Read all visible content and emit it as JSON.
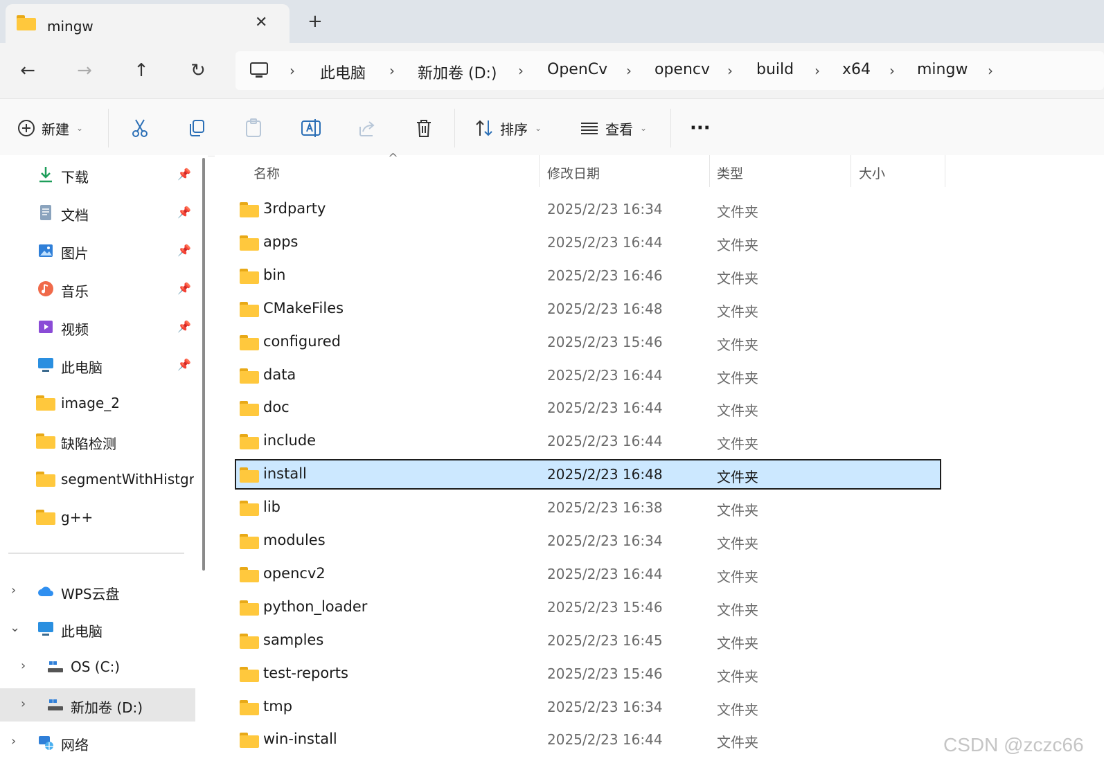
{
  "tab": {
    "title": "mingw",
    "close": "✕",
    "new_tab": "+"
  },
  "nav": {
    "back": "←",
    "forward": "→",
    "up": "↑",
    "refresh": "↻"
  },
  "breadcrumb": [
    "此电脑",
    "新加卷 (D:)",
    "OpenCv",
    "opencv",
    "build",
    "x64",
    "mingw"
  ],
  "toolbar": {
    "new_label": "新建",
    "sort_label": "排序",
    "view_label": "查看",
    "more": "···"
  },
  "sidebar": {
    "quick": [
      {
        "label": "下载",
        "icon": "download-icon"
      },
      {
        "label": "文档",
        "icon": "document-icon"
      },
      {
        "label": "图片",
        "icon": "pictures-icon"
      },
      {
        "label": "音乐",
        "icon": "music-icon"
      },
      {
        "label": "视频",
        "icon": "video-icon"
      },
      {
        "label": "此电脑",
        "icon": "computer-icon"
      },
      {
        "label": "image_2",
        "icon": "folder-icon"
      },
      {
        "label": "缺陷检测",
        "icon": "folder-icon"
      },
      {
        "label": "segmentWithHistgr",
        "icon": "folder-icon"
      },
      {
        "label": "g++",
        "icon": "folder-icon"
      }
    ],
    "tree": [
      {
        "label": "WPS云盘",
        "icon": "cloud-icon"
      },
      {
        "label": "此电脑",
        "icon": "computer-icon"
      },
      {
        "label": "OS (C:)",
        "icon": "drive-icon"
      },
      {
        "label": "新加卷 (D:)",
        "icon": "drive-icon"
      },
      {
        "label": "网络",
        "icon": "network-icon"
      }
    ]
  },
  "columns": {
    "name": "名称",
    "date": "修改日期",
    "type": "类型",
    "size": "大小"
  },
  "files": [
    {
      "name": "3rdparty",
      "date": "2025/2/23 16:34",
      "type": "文件夹"
    },
    {
      "name": "apps",
      "date": "2025/2/23 16:44",
      "type": "文件夹"
    },
    {
      "name": "bin",
      "date": "2025/2/23 16:46",
      "type": "文件夹"
    },
    {
      "name": "CMakeFiles",
      "date": "2025/2/23 16:48",
      "type": "文件夹"
    },
    {
      "name": "configured",
      "date": "2025/2/23 15:46",
      "type": "文件夹"
    },
    {
      "name": "data",
      "date": "2025/2/23 16:44",
      "type": "文件夹"
    },
    {
      "name": "doc",
      "date": "2025/2/23 16:44",
      "type": "文件夹"
    },
    {
      "name": "include",
      "date": "2025/2/23 16:44",
      "type": "文件夹"
    },
    {
      "name": "install",
      "date": "2025/2/23 16:48",
      "type": "文件夹"
    },
    {
      "name": "lib",
      "date": "2025/2/23 16:38",
      "type": "文件夹"
    },
    {
      "name": "modules",
      "date": "2025/2/23 16:34",
      "type": "文件夹"
    },
    {
      "name": "opencv2",
      "date": "2025/2/23 16:44",
      "type": "文件夹"
    },
    {
      "name": "python_loader",
      "date": "2025/2/23 15:46",
      "type": "文件夹"
    },
    {
      "name": "samples",
      "date": "2025/2/23 16:45",
      "type": "文件夹"
    },
    {
      "name": "test-reports",
      "date": "2025/2/23 15:46",
      "type": "文件夹"
    },
    {
      "name": "tmp",
      "date": "2025/2/23 16:34",
      "type": "文件夹"
    },
    {
      "name": "win-install",
      "date": "2025/2/23 16:44",
      "type": "文件夹"
    }
  ],
  "selected_file": "install",
  "watermark": "CSDN @zczc66"
}
